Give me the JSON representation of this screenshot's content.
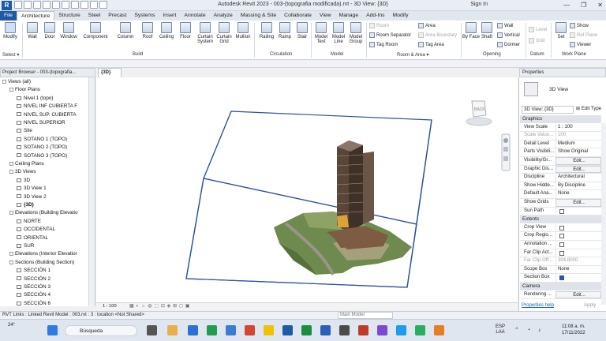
{
  "titlebar": {
    "title": "Autodesk Revit 2023 - 003-(topografia modificada).rvt - 3D View: {3D}",
    "sign_in": "Sign In"
  },
  "tabs": [
    "File",
    "Architecture",
    "Structure",
    "Steel",
    "Precast",
    "Systems",
    "Insert",
    "Annotate",
    "Analyze",
    "Massing & Site",
    "Collaborate",
    "View",
    "Manage",
    "Add-Ins",
    "Modify"
  ],
  "ribbon": {
    "modify": "Modify",
    "build_buttons": [
      "Wall",
      "Door",
      "Window",
      "Component",
      "Column",
      "Roof",
      "Ceiling",
      "Floor",
      "Curtain System",
      "Curtain Grid",
      "Mullion"
    ],
    "circulation_buttons": [
      "Railing",
      "Ramp",
      "Stair"
    ],
    "model_buttons": [
      "Model Text",
      "Model Line",
      "Model Group"
    ],
    "room_items": [
      "Room",
      "Room Separator",
      "Tag Room",
      "Area",
      "Area Boundary",
      "Tag Area"
    ],
    "opening_buttons": [
      "By Face",
      "Shaft",
      "Wall",
      "Vertical",
      "Dormer"
    ],
    "datum_items": [
      "Level",
      "Grid"
    ],
    "workplane_items": [
      "Set",
      "Show",
      "Ref Plane",
      "Viewer"
    ],
    "panel_labels": [
      "Select ▾",
      "Build",
      "Circulation",
      "Model",
      "Room & Area ▾",
      "Opening",
      "Datum",
      "Work Plane"
    ]
  },
  "project_browser": {
    "title": "Project Browser - 003-(topografia...",
    "items": [
      "Views (all)",
      "Floor Plans",
      "Nivel 1 (topo)",
      "NIVEL INF CUBIERTA F",
      "NIVEL SUP. CUBIERTA",
      "NIVEL SUPERIOR",
      "Site",
      "SOTANO 1 (TOPO)",
      "SOTANO 2 (TOPO)",
      "SOTANO 3 (TOPO)",
      "Ceiling Plans",
      "3D Views",
      "3D",
      "3D View 1",
      "3D View 2",
      "{3D}",
      "Elevations (Building Elevatio",
      "NORTE",
      "OCCIDENTAL",
      "ORIENTAL",
      "SUR",
      "Elevations (Interior Elevatior",
      "Sections (Building Section)",
      "SECCIÓN 1",
      "SECCIÓN 2",
      "SECCIÓN 3",
      "SECCIÓN 4",
      "SECCIÓN 6"
    ]
  },
  "view_tab": "{3D}",
  "viewcube_label": "BACK",
  "view_scale_label": "1 : 100",
  "properties": {
    "title": "Properties",
    "type_name": "3D View",
    "selector": "3D View: {3D}",
    "edit_type": "Edit Type",
    "graphics_header": "Graphics",
    "rows": [
      {
        "k": "View Scale",
        "v": "1 : 100"
      },
      {
        "k": "Scale Value...",
        "v": "100"
      },
      {
        "k": "Detail Level",
        "v": "Medium"
      },
      {
        "k": "Parts Visibili...",
        "v": "Show Original"
      },
      {
        "k": "Visibility/Gr...",
        "v": "Edit..."
      },
      {
        "k": "Graphic Dis...",
        "v": "Edit..."
      },
      {
        "k": "Discipline",
        "v": "Architectural"
      },
      {
        "k": "Show Hidde...",
        "v": "By Discipline"
      },
      {
        "k": "Default Ana...",
        "v": "None"
      },
      {
        "k": "Show Grids",
        "v": "Edit..."
      },
      {
        "k": "Sun Path",
        "v": ""
      }
    ],
    "extents_header": "Extents",
    "extents_rows": [
      {
        "k": "Crop View",
        "v": ""
      },
      {
        "k": "Crop Regio...",
        "v": ""
      },
      {
        "k": "Annotation ...",
        "v": ""
      },
      {
        "k": "Far Clip Act...",
        "v": ""
      },
      {
        "k": "Far Clip Off...",
        "v": "304.8000"
      },
      {
        "k": "Scope Box",
        "v": "None"
      },
      {
        "k": "Section Box",
        "v": ""
      }
    ],
    "camera_header": "Camera",
    "camera_rows": [
      {
        "k": "Rendering ...",
        "v": "Edit..."
      }
    ],
    "help": "Properties help",
    "apply": "Apply"
  },
  "statusbar": {
    "text": "RVT Links : Linked Revit Model : 003.rvt : 3 : location <Not Shared>",
    "workset": "Main Model"
  },
  "taskbar": {
    "weather": "24°",
    "search": "Búsqueda",
    "lang": "ESP",
    "lang2": "LAA",
    "time": "11:08 a. m.",
    "date": "17/11/2022"
  },
  "colors": {
    "file_tab": "#1f5aa6",
    "section_box": "#2e4fa8",
    "terrain": "#6f8a4e"
  }
}
